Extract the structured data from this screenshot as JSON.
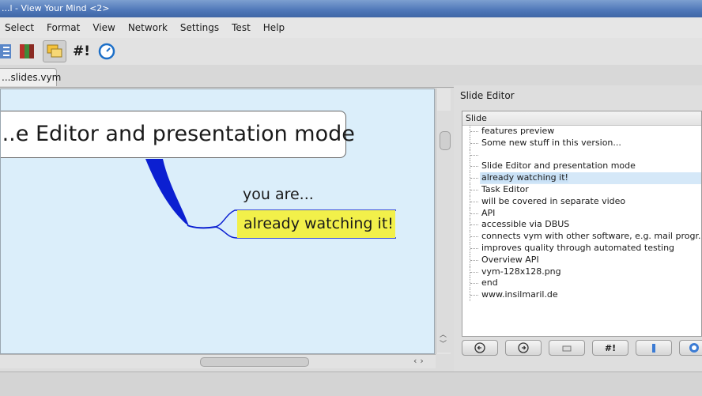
{
  "window": {
    "title": "...l - View Your Mind <2>"
  },
  "menu": [
    "Select",
    "Format",
    "View",
    "Network",
    "Settings",
    "Test",
    "Help"
  ],
  "toolbar": {
    "hash_label": "#!"
  },
  "tabs": [
    {
      "label": "...slides.vym"
    }
  ],
  "map": {
    "main_node": "...e Editor and presentation mode",
    "branch_label": "you are...",
    "highlighted_node": "already watching it!",
    "highlight_color": "#f2f04a",
    "link_color": "#0b1fd1",
    "canvas_color": "#dbeefa"
  },
  "slide_editor": {
    "title": "Slide Editor",
    "column_header": "Slide",
    "items": [
      "features preview",
      "Some new stuff in this version...",
      "",
      "Slide Editor and presentation mode",
      "already watching it!",
      "Task Editor",
      "will be covered in separate video",
      "API",
      "accessible via DBUS",
      "connects vym with other software, e.g. mail progr...",
      "improves quality through automated testing",
      "Overview API",
      "vym-128x128.png",
      "end",
      "www.insilmaril.de"
    ],
    "selected_index": 4,
    "buttons": {
      "hash_label": "#!"
    }
  }
}
